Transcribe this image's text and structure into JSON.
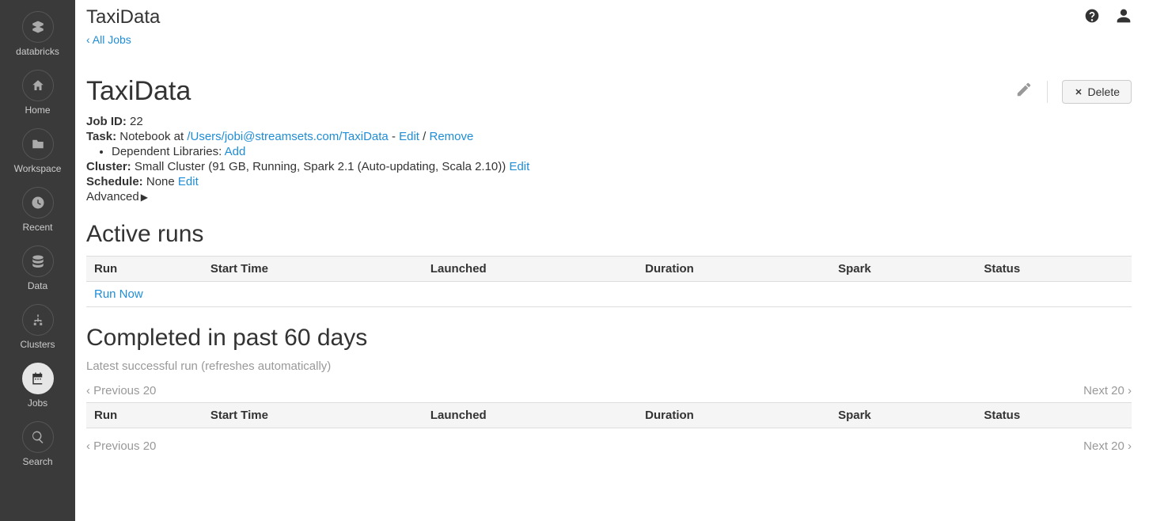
{
  "brand": "databricks",
  "sidebar": {
    "items": [
      {
        "label": "Home"
      },
      {
        "label": "Workspace"
      },
      {
        "label": "Recent"
      },
      {
        "label": "Data"
      },
      {
        "label": "Clusters"
      },
      {
        "label": "Jobs"
      },
      {
        "label": "Search"
      }
    ]
  },
  "topbar": {
    "title": "TaxiData"
  },
  "breadcrumb": {
    "all_jobs": "‹ All Jobs"
  },
  "job": {
    "title": "TaxiData",
    "delete_label": "Delete",
    "id_label": "Job ID:",
    "id_value": "22",
    "task_label": "Task:",
    "task_prefix": "Notebook at ",
    "task_path": "/Users/jobi@streamsets.com/TaxiData",
    "task_sep1": " - ",
    "task_edit": "Edit",
    "task_sep2": " / ",
    "task_remove": "Remove",
    "deps_label": "Dependent Libraries: ",
    "deps_add": "Add",
    "cluster_label": "Cluster:",
    "cluster_value": "Small Cluster (91 GB, Running, Spark 2.1 (Auto-updating, Scala 2.10)) ",
    "cluster_edit": "Edit",
    "schedule_label": "Schedule:",
    "schedule_value": "None ",
    "schedule_edit": "Edit",
    "advanced_label": "Advanced"
  },
  "active": {
    "heading": "Active runs",
    "cols": {
      "run": "Run",
      "start": "Start Time",
      "launched": "Launched",
      "duration": "Duration",
      "spark": "Spark",
      "status": "Status"
    },
    "run_now": "Run Now"
  },
  "completed": {
    "heading": "Completed in past 60 days",
    "subnote": "Latest successful run (refreshes automatically)",
    "prev": "‹ Previous 20",
    "next": "Next 20 ›",
    "cols": {
      "run": "Run",
      "start": "Start Time",
      "launched": "Launched",
      "duration": "Duration",
      "spark": "Spark",
      "status": "Status"
    }
  }
}
